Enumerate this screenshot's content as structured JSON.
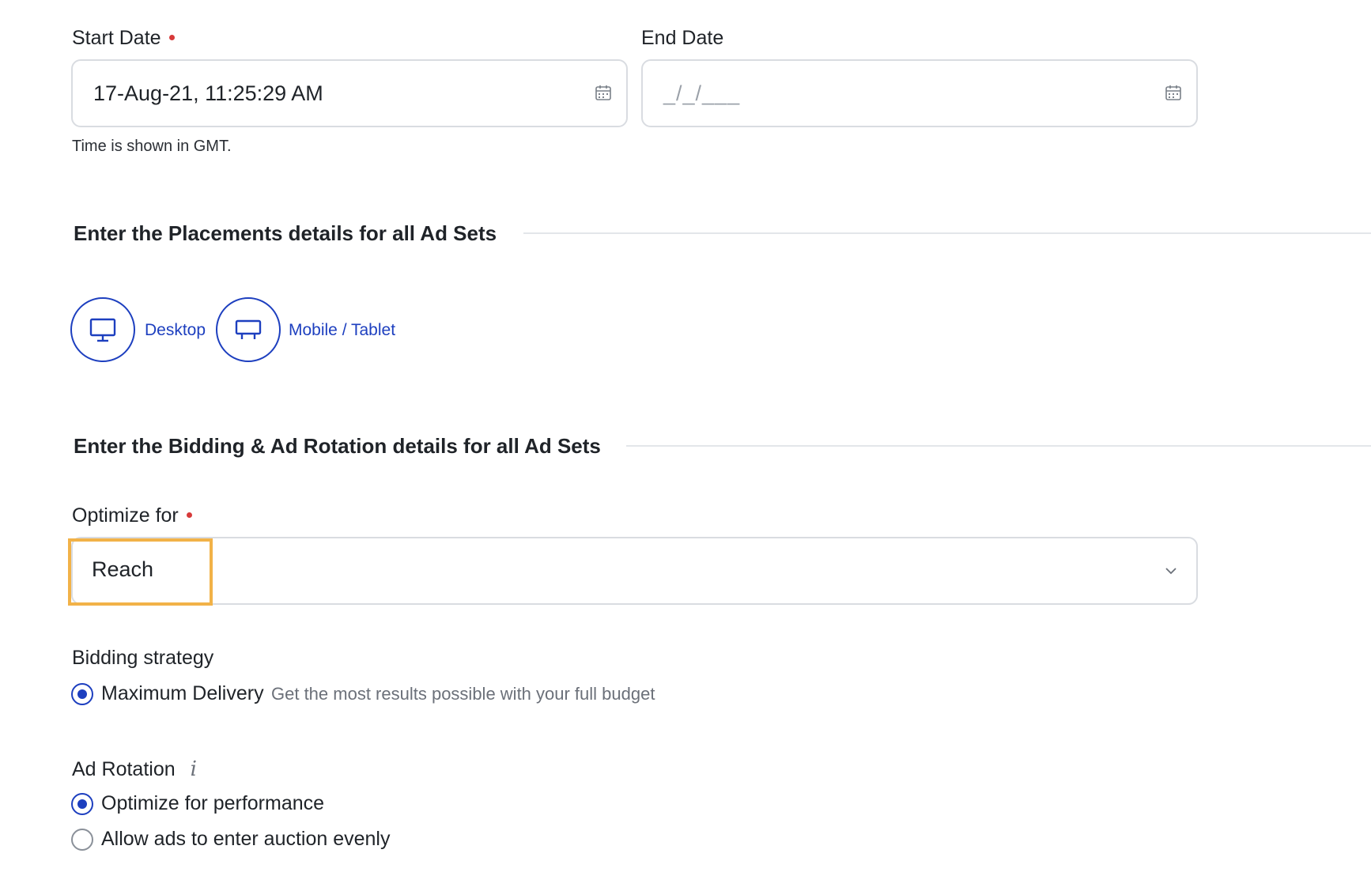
{
  "start_date": {
    "label": "Start Date",
    "value": "17-Aug-21, 11:25:29 AM",
    "icon": "calendar-icon",
    "help_text": "Time is shown in GMT."
  },
  "end_date": {
    "label": "End Date",
    "placeholder": "_/_/___",
    "icon": "calendar-icon"
  },
  "placements": {
    "title": "Enter the Placements details for all Ad Sets",
    "options": [
      {
        "label": "Desktop",
        "icon": "desktop-icon"
      },
      {
        "label": "Mobile / Tablet",
        "icon": "mobile-tablet-icon"
      }
    ]
  },
  "bidding": {
    "title": "Enter the Bidding & Ad Rotation details for all Ad Sets",
    "optimize_for": {
      "label": "Optimize for",
      "value": "Reach",
      "icon": "chevron-down-icon"
    },
    "strategy": {
      "label": "Bidding strategy",
      "option_label": "Maximum Delivery",
      "option_desc": "Get the most results possible with your full budget",
      "selected": true
    },
    "ad_rotation": {
      "label": "Ad Rotation",
      "info_icon": "info-icon",
      "info_glyph": "i",
      "options": [
        {
          "label": "Optimize for performance",
          "selected": true
        },
        {
          "label": "Allow ads to enter auction evenly",
          "selected": false
        }
      ]
    }
  },
  "colors": {
    "accent": "#1d3fbf",
    "required": "#d73a3a",
    "highlight": "#f2b248",
    "border": "#d9dce1"
  }
}
